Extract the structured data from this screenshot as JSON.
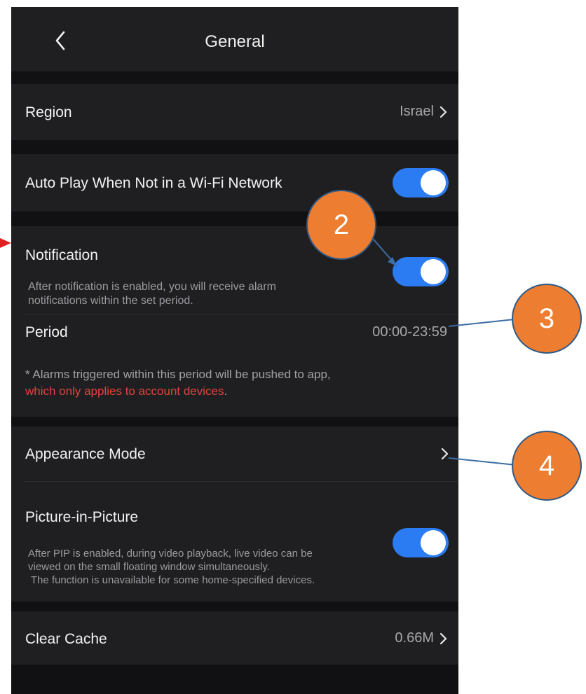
{
  "header": {
    "title": "General",
    "back_icon": "chevron-left-icon"
  },
  "region": {
    "label": "Region",
    "value": "Israel"
  },
  "auto_play": {
    "label": "Auto Play When Not in a Wi-Fi Network",
    "enabled": true
  },
  "notification": {
    "label": "Notification",
    "enabled": true,
    "description_line1": "After notification is enabled, you will receive alarm",
    "description_line2": "notifications within the set period."
  },
  "period": {
    "label": "Period",
    "value": "00:00-23:59",
    "note": "* Alarms triggered within this period will be pushed to app,",
    "note_red": "which only applies to account devices",
    "note_end": "."
  },
  "appearance": {
    "label": "Appearance Mode"
  },
  "pip": {
    "label": "Picture-in-Picture",
    "enabled": true,
    "description_line1": "After PIP is enabled, during video playback, live video can be",
    "description_line2": "viewed on the small floating window simultaneously.",
    "description_line3": " The function is unavailable for some home-specified devices."
  },
  "cache": {
    "label": "Clear Cache",
    "value": "0.66M"
  },
  "callouts": [
    "2",
    "3",
    "4"
  ],
  "colors": {
    "accent": "#2b7cf2",
    "callout": "#ed7d31",
    "warning": "#e0443e",
    "arrow": "#e02020"
  }
}
